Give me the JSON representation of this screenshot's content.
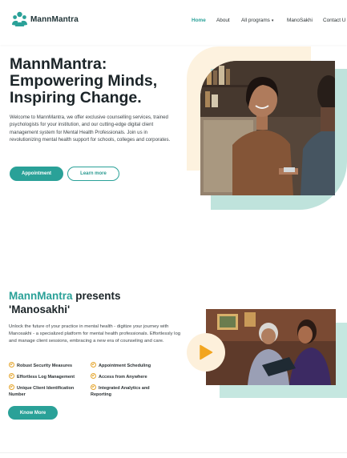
{
  "brand": {
    "name": "MannMantra",
    "primary": "#2aa198",
    "accent": "#e5a62f"
  },
  "nav": {
    "items": [
      {
        "label": "Home",
        "active": true
      },
      {
        "label": "About"
      },
      {
        "label": "All programs"
      },
      {
        "label": "ManoSakhi"
      },
      {
        "label": "Contact U"
      }
    ]
  },
  "hero": {
    "title": "MannMantra: Empowering Minds, Inspiring Change.",
    "description": "Welcome to MannMantra, we offer exclusive counselling services, trained psychologists for your institution, and our cutting-edge digital client management system for Mental Health Professionals. Join us in revolutionizing mental health support for schools, colleges and corporates.",
    "primary_button": "Appointment",
    "secondary_button": "Learn more"
  },
  "manosakhi": {
    "title_highlight": "MannMantra",
    "title_rest": " presents 'Manosakhi'",
    "description": "Unlock the future of your practice in mental health - digitize your journey with Manosakhi - a specialized platform for mental health professionals. Effortlessly log and manage client sessions, embracing a new era of counseling and care.",
    "features": [
      "Robust Security Measures",
      "Appointment Scheduling",
      "Effortless Log Management",
      "Access from Anywhere",
      "Unique Client Identification Number",
      "Integrated Analytics and Reporting"
    ],
    "button": "Know More"
  }
}
